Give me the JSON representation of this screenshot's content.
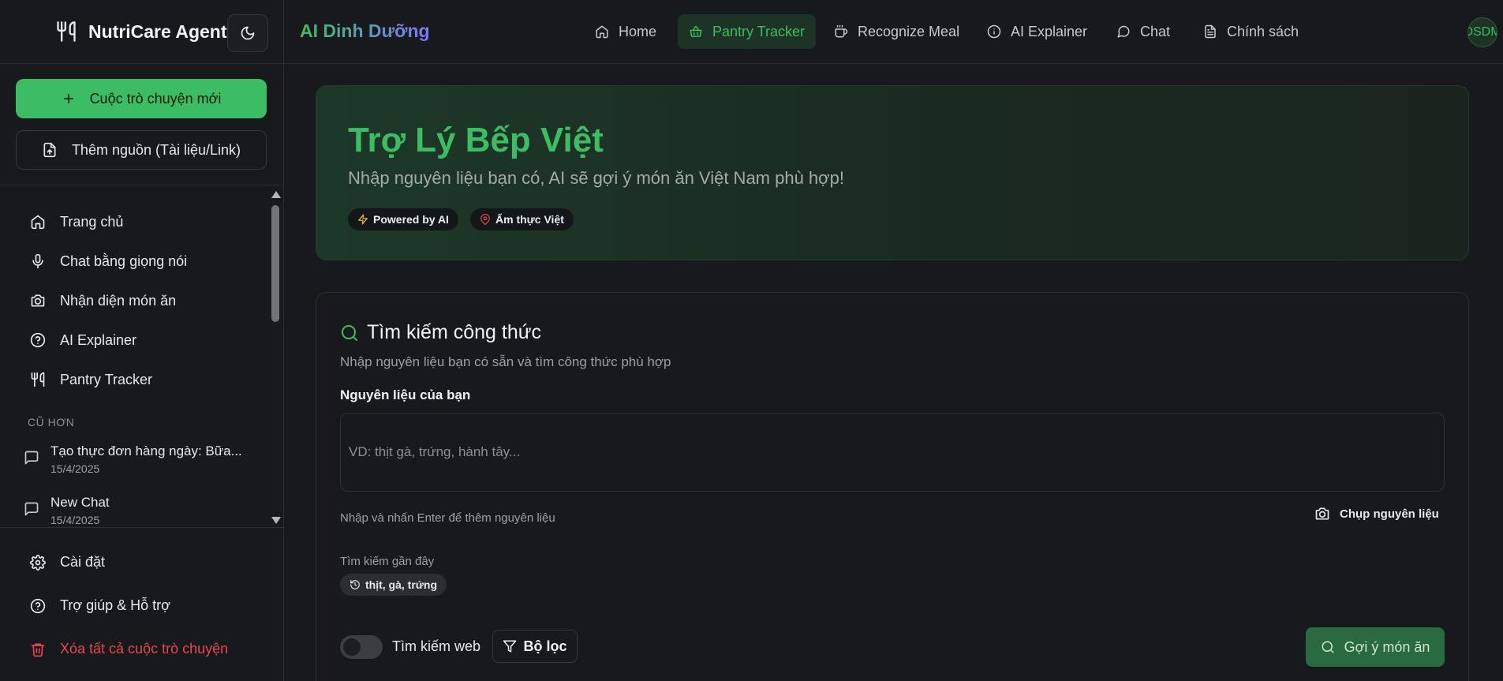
{
  "sidebar": {
    "brand": "NutriCare Agents",
    "new_chat_label": "Cuộc trò chuyện mới",
    "add_source_label": "Thêm nguồn (Tài liệu/Link)",
    "nav_items": [
      {
        "label": "Trang chủ",
        "icon": "home-icon"
      },
      {
        "label": "Chat bằng giọng nói",
        "icon": "mic-icon"
      },
      {
        "label": "Nhận diện món ăn",
        "icon": "camera-icon"
      },
      {
        "label": "AI Explainer",
        "icon": "help-circle-icon"
      },
      {
        "label": "Pantry Tracker",
        "icon": "utensils-icon"
      }
    ],
    "section_older": "CŨ HƠN",
    "chats": [
      {
        "title": "Tạo thực đơn hàng ngày: Bữa...",
        "date": "15/4/2025"
      },
      {
        "title": "New Chat",
        "date": "15/4/2025"
      }
    ],
    "settings_label": "Cài đặt",
    "help_label": "Trợ giúp & Hỗ trợ",
    "clear_label": "Xóa tất cả cuộc trò chuyện"
  },
  "topbar": {
    "app_title": "AI Dinh Dưỡng",
    "tabs": [
      {
        "label": "Home",
        "icon": "home-icon",
        "active": false
      },
      {
        "label": "Pantry Tracker",
        "icon": "basket-icon",
        "active": true
      },
      {
        "label": "Recognize Meal",
        "icon": "coffee-icon",
        "active": false
      },
      {
        "label": "AI Explainer",
        "icon": "info-icon",
        "active": false
      },
      {
        "label": "Chat",
        "icon": "message-icon",
        "active": false
      },
      {
        "label": "Chính sách",
        "icon": "document-icon",
        "active": false
      }
    ],
    "avatar_text": "DSDM"
  },
  "hero": {
    "title": "Trợ Lý Bếp Việt",
    "subtitle": "Nhập nguyên liệu bạn có, AI sẽ gợi ý món ăn Việt Nam phù hợp!",
    "badges": [
      "Powered by AI",
      "Ẩm thực Việt"
    ]
  },
  "search": {
    "heading": "Tìm kiếm công thức",
    "description": "Nhập nguyên liệu bạn có sẵn và tìm công thức phù hợp",
    "ingredients_label": "Nguyên liệu của bạn",
    "ingredients_placeholder": "VD: thịt gà, trứng, hành tây...",
    "ingredients_value": "",
    "hint": "Nhập và nhấn Enter để thêm nguyên liệu",
    "capture_label": "Chụp nguyên liệu",
    "recent_label": "Tìm kiếm gần đây",
    "recent_chip": "thịt, gà, trứng",
    "web_search_label": "Tìm kiếm web",
    "web_search_enabled": false,
    "filter_label": "Bộ lọc",
    "suggest_label": "Gợi ý món ăn"
  },
  "colors": {
    "accent": "#3dbd63",
    "background": "#17191d",
    "danger": "#e5484d",
    "title_gradient_end": "#7a78ff"
  }
}
